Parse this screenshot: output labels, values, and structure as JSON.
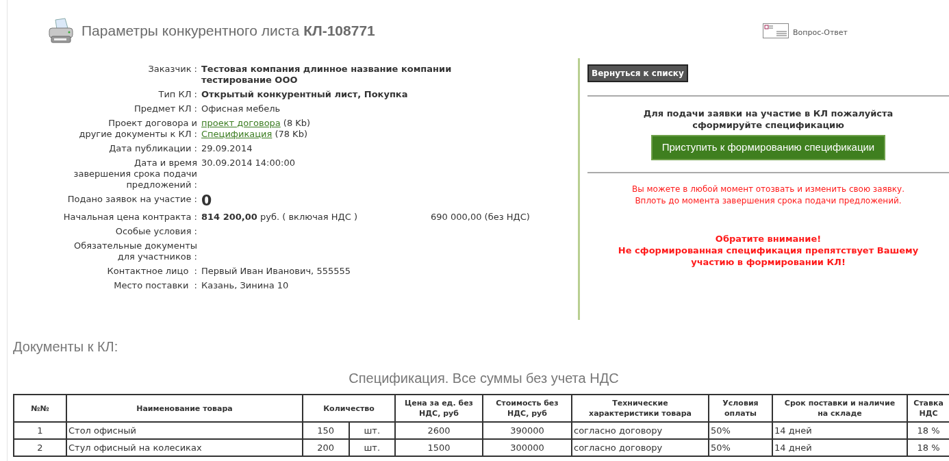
{
  "header": {
    "title": "Параметры конкурентного листа",
    "number": "КЛ-108771",
    "faq_link": "Вопрос-Ответ"
  },
  "info": [
    {
      "kind": "bold",
      "label": [
        "Заказчик :"
      ],
      "value": "Тестовая компания длинное название компании тестирование ООО"
    },
    {
      "kind": "bold",
      "label": [
        "Тип КЛ :"
      ],
      "value": "Открытый конкурентный лист, Покупка"
    },
    {
      "kind": "plain",
      "label": [
        "Предмет КЛ :"
      ],
      "value": "Офисная мебель"
    },
    {
      "kind": "links",
      "label": [
        "Проект договора и",
        "другие документы к КЛ :"
      ],
      "links": [
        {
          "text": "проект договора",
          "size": "(8 Kb)"
        },
        {
          "text": "Спецификация",
          "size": "(78 Kb)"
        }
      ]
    },
    {
      "kind": "plain",
      "label": [
        "Дата публикации :"
      ],
      "value": "29.09.2014"
    },
    {
      "kind": "plain",
      "label": [
        "Дата и время",
        "завершения срока подачи",
        "предложений :"
      ],
      "value": "30.09.2014 14:00:00"
    },
    {
      "kind": "count",
      "label": [
        "Подано заявок на участие :"
      ],
      "value": "0"
    },
    {
      "kind": "price",
      "label": [
        "Начальная цена контракта :"
      ],
      "value": "**814 200,00** руб. ( включая НДС )",
      "extra": "690 000,00 (без НДС)"
    },
    {
      "kind": "plain",
      "label": [
        "Особые условия :"
      ]
    },
    {
      "kind": "plain",
      "label": [
        "Обязательные документы",
        "для участников :"
      ]
    },
    {
      "kind": "plain",
      "label": [
        "Контактное лицо  :"
      ],
      "value": "Первый Иван Иванович, 555555"
    },
    {
      "kind": "plain",
      "label": [
        "Место поставки  :"
      ],
      "value": "Казань, Зинина 10"
    }
  ],
  "side": {
    "back_button": "Вернуться к списку",
    "prompt": "Для подачи заявки на участие в КЛ пожалуйста сформируйте спецификацию",
    "start_button": "Приступить к формированию спецификации",
    "note": [
      "Вы можете в любой момент отозвать и изменить свою заявку.",
      "Вплоть до момента завершения срока подачи предложений."
    ],
    "warning": [
      "Обратите внимание!",
      "Не сформированная спецификация препятствует Вашему участию в формировании КЛ!"
    ]
  },
  "documents_heading": "Документы к КЛ:",
  "spec": {
    "title": "Спецификация. Все суммы без учета НДС",
    "columns": [
      "№№",
      "Наименование товара",
      "Количество",
      "Цена за ед. без НДС, руб",
      "Стоимость без НДС, руб",
      "Технические характеристики товара",
      "Условия оплаты",
      "Срок поставки и наличие на складе",
      "Ставка НДС"
    ],
    "rows": [
      [
        "1",
        "Стол офисный",
        [
          "150",
          "шт."
        ],
        "2600",
        "390000",
        "согласно договору",
        "50%",
        "14 дней",
        "18 %"
      ],
      [
        "2",
        "Стул офисный на колесиках",
        [
          "200",
          "шт."
        ],
        "1500",
        "300000",
        "согласно договору",
        "50%",
        "14 дней",
        "18 %"
      ]
    ]
  }
}
